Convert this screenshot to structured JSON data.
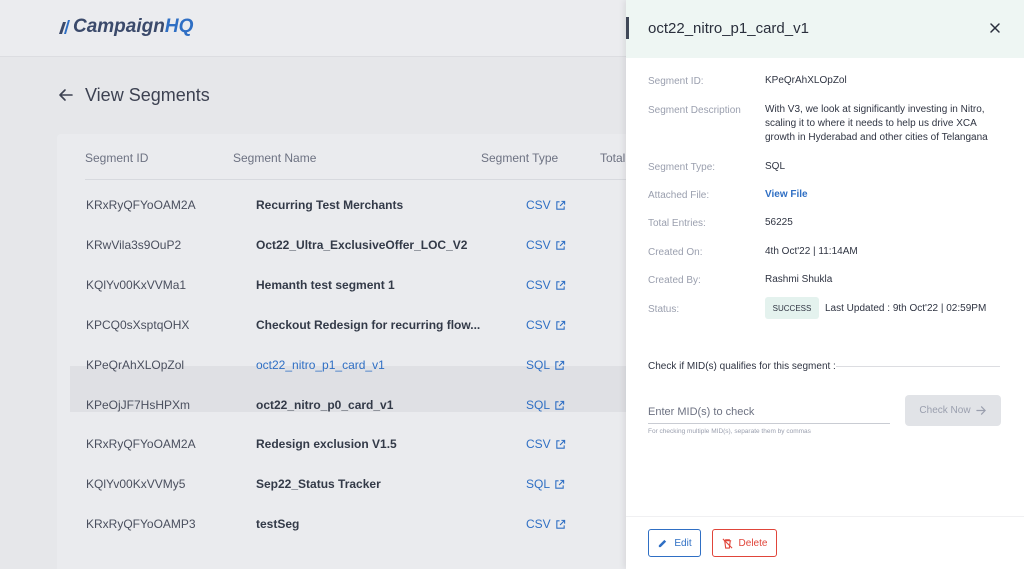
{
  "app": {
    "brand_part1": "Campaign",
    "brand_part2": "HQ"
  },
  "page": {
    "title": "View Segments"
  },
  "table": {
    "headers": {
      "id": "Segment ID",
      "name": "Segment Name",
      "type": "Segment Type",
      "total": "Total"
    },
    "rows": [
      {
        "id": "KRxRyQFYoOAM2A",
        "name": "Recurring Test Merchants",
        "type": "CSV"
      },
      {
        "id": "KRwVila3s9OuP2",
        "name": "Oct22_Ultra_ExclusiveOffer_LOC_V2",
        "type": "CSV"
      },
      {
        "id": "KQlYv00KxVVMa1",
        "name": "Hemanth test segment 1",
        "type": "CSV"
      },
      {
        "id": "KPCQ0sXsptqOHX",
        "name": "Checkout Redesign for recurring flow...",
        "type": "CSV"
      },
      {
        "id": "KPeQrAhXLOpZol",
        "name": "oct22_nitro_p1_card_v1",
        "type": "SQL"
      },
      {
        "id": "KPeOjJF7HsHPXm",
        "name": "oct22_nitro_p0_card_v1",
        "type": "SQL"
      },
      {
        "id": "KRxRyQFYoOAM2A",
        "name": "Redesign exclusion V1.5",
        "type": "CSV"
      },
      {
        "id": "KQlYv00KxVVMy5",
        "name": "Sep22_Status Tracker",
        "type": "SQL"
      },
      {
        "id": "KRxRyQFYoOAMP3",
        "name": "testSeg",
        "type": "CSV"
      }
    ]
  },
  "drawer": {
    "title": "oct22_nitro_p1_card_v1",
    "labels": {
      "segment_id": "Segment ID:",
      "description": "Segment Description",
      "segment_type": "Segment Type:",
      "attached_file": "Attached File:",
      "total_entries": "Total Entries:",
      "created_on": "Created On:",
      "created_by": "Created By:",
      "status": "Status:"
    },
    "values": {
      "segment_id": "KPeQrAhXLOpZol",
      "description": "With V3, we look at significantly investing in Nitro, scaling it to where it needs to help us drive XCA growth in Hyderabad and other cities of Telangana",
      "segment_type": "SQL",
      "attached_file": "View File",
      "total_entries": "56225",
      "created_on": "4th Oct'22 | 11:14AM",
      "created_by": "Rashmi Shukla",
      "status_badge": "SUCCESS",
      "last_updated": "Last Updated : 9th Oct'22 | 02:59PM"
    },
    "check": {
      "title": "Check if MID(s) qualifies for this segment :",
      "placeholder": "Enter MID(s) to check",
      "helper": "For checking multiple MID(s), separate them by commas",
      "button": "Check Now"
    },
    "actions": {
      "edit": "Edit",
      "delete": "Delete"
    }
  },
  "colors": {
    "accent": "#2f6fc4",
    "danger": "#e0453a",
    "success_bg": "#e4f2ee"
  }
}
